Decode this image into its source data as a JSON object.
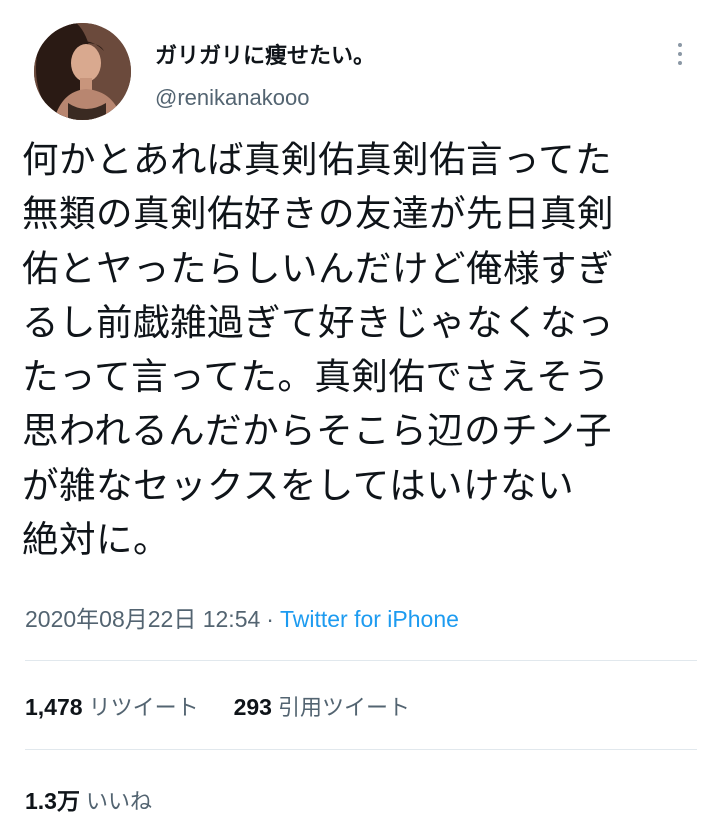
{
  "user": {
    "display_name": "ガリガリに痩せたい。",
    "handle": "@renikanakooo"
  },
  "tweet": {
    "lines": [
      "何かとあれば真剣佑真剣佑言ってた",
      "無類の真剣佑好きの友達が先日真剣",
      "佑とヤったらしいんだけど俺様すぎ",
      "るし前戯雑過ぎて好きじゃなくなっ",
      "たって言ってた。真剣佑でさえそう",
      "思われるんだからそこら辺のチン子",
      "が雑なセックスをしてはいけない",
      "絶対に。"
    ]
  },
  "meta": {
    "timestamp": "2020年08月22日 12:54",
    "separator": "·",
    "source": "Twitter for iPhone"
  },
  "stats": {
    "retweets_count": "1,478",
    "retweets_label": "リツイート",
    "quotes_count": "293",
    "quotes_label": "引用ツイート",
    "likes_count": "1.3万",
    "likes_label": "いいね"
  },
  "icons": {
    "more": "more-vertical-icon"
  },
  "colors": {
    "text": "#0f1419",
    "secondary": "#536471",
    "link": "#1d9bf0",
    "divider": "#e1e8ed"
  }
}
